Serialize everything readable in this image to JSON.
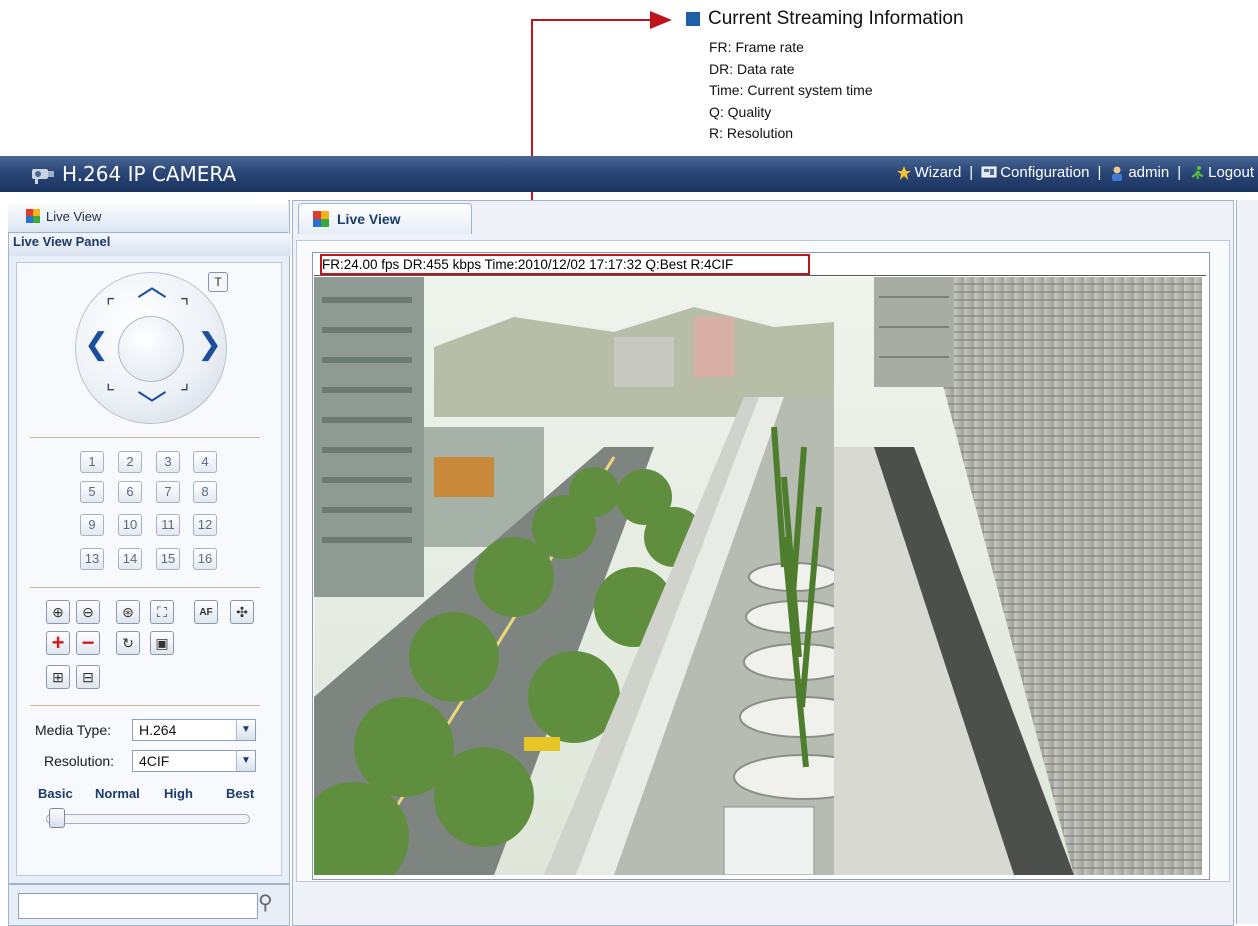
{
  "annotation": {
    "title": "Current Streaming Information",
    "definitions": [
      "FR: Frame rate",
      "DR: Data rate",
      "Time: Current system time",
      "Q: Quality",
      "R: Resolution"
    ]
  },
  "header": {
    "title": "H.264 IP CAMERA",
    "nav": {
      "wizard": "Wizard",
      "configuration": "Configuration",
      "admin": "admin",
      "logout": "Logout",
      "sep": "|"
    }
  },
  "left_panel": {
    "tab_label": "Live View",
    "panel_title": "Live View Panel",
    "t_button": "T",
    "presets": [
      "1",
      "2",
      "3",
      "4",
      "5",
      "6",
      "7",
      "8",
      "9",
      "10",
      "11",
      "12",
      "13",
      "14",
      "15",
      "16"
    ],
    "media_type_label": "Media Type:",
    "media_type_value": "H.264",
    "resolution_label": "Resolution:",
    "resolution_value": "4CIF",
    "quality_levels": [
      "Basic",
      "Normal",
      "High",
      "Best"
    ],
    "quality_slider_position": 0
  },
  "main": {
    "tab_label": "Live View",
    "stream_info": "FR:24.00 fps  DR:455 kbps Time:2010/12/02 17:17:32 Q:Best R:4CIF"
  },
  "colors": {
    "accent_blue": "#1f5fa8",
    "annotation_red": "#c0141c",
    "header_dark": "#1b3560"
  }
}
